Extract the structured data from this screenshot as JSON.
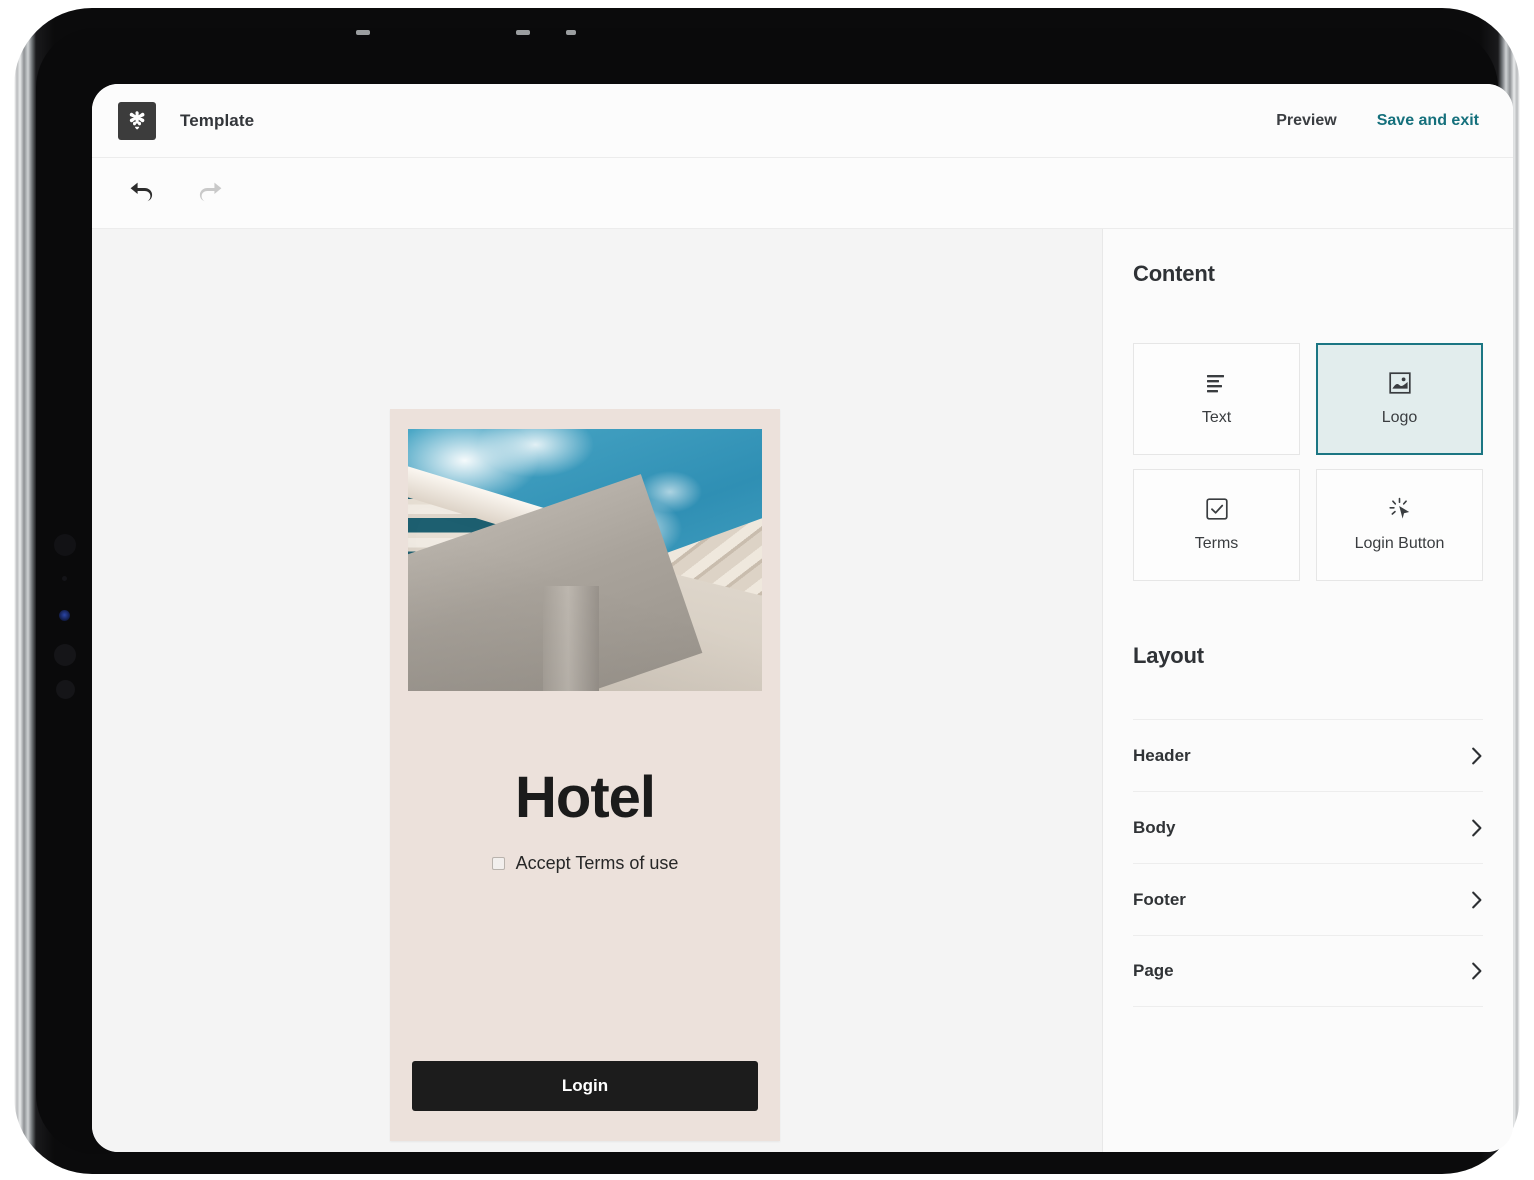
{
  "app": {
    "logo_icon": "brand-mark-icon",
    "title": "Template"
  },
  "header": {
    "preview_label": "Preview",
    "save_exit_label": "Save and exit",
    "save_exit_color": "#15707c"
  },
  "toolbar": {
    "undo_icon": "undo-icon",
    "undo_state": "enabled",
    "redo_icon": "redo-icon",
    "redo_state": "disabled"
  },
  "canvas": {
    "background_color": "#f4f4f4",
    "preview": {
      "card_background": "#ece1db",
      "image_alt": "modern-building-low-angle-photo",
      "heading": "Hotel",
      "terms_label": "Accept Terms of use",
      "terms_checked": false,
      "login_label": "Login",
      "login_background": "#1c1c1c"
    }
  },
  "side_panel": {
    "content": {
      "heading": "Content",
      "cards": [
        {
          "label": "Text",
          "icon": "text-lines-icon",
          "selected": false
        },
        {
          "label": "Logo",
          "icon": "image-icon",
          "selected": true
        },
        {
          "label": "Terms",
          "icon": "checkbox-check-icon",
          "selected": false
        },
        {
          "label": "Login Button",
          "icon": "cursor-click-icon",
          "selected": false
        }
      ],
      "selected_border_color": "#1b7683",
      "selected_fill_color": "#e2eded"
    },
    "layout": {
      "heading": "Layout",
      "rows": [
        {
          "label": "Header",
          "icon": "chevron-right-icon"
        },
        {
          "label": "Body",
          "icon": "chevron-right-icon"
        },
        {
          "label": "Footer",
          "icon": "chevron-right-icon"
        },
        {
          "label": "Page",
          "icon": "chevron-right-icon"
        }
      ]
    }
  },
  "device": {
    "type": "tablet-frame",
    "camera_icon": "front-camera-icon",
    "sensor_icon": "ambient-sensor-icon",
    "indicator_icon": "status-indicator-icon"
  }
}
